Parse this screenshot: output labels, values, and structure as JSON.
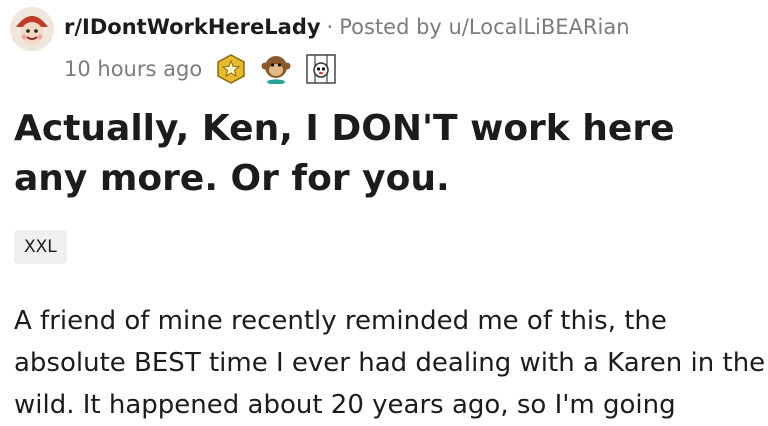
{
  "post": {
    "subreddit": "r/IDontWorkHereLady",
    "separator": "·",
    "posted_by": "Posted by u/LocalLiBEARian",
    "timestamp": "10 hours ago",
    "awards": [
      {
        "icon": "gold-star-award-icon"
      },
      {
        "icon": "monkey-award-icon"
      },
      {
        "icon": "dog-award-icon"
      }
    ],
    "title": "Actually, Ken, I DON'T work here any more. Or for you.",
    "flair": "XXL",
    "body": "A friend of mine recently reminded me of this, the absolute BEST time I ever had dealing with a Karen in the wild. It happened about 20 years ago, so I'm going"
  },
  "colors": {
    "text": "#1c1c1c",
    "meta": "#7c7c7c",
    "flair_bg": "#edeff1"
  }
}
